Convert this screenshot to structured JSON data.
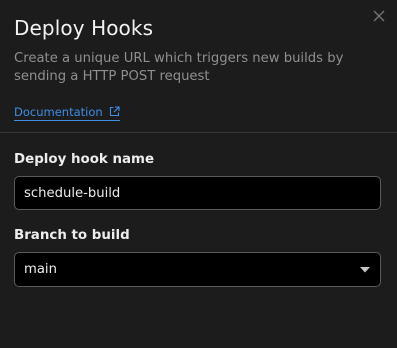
{
  "dialog": {
    "title": "Deploy Hooks",
    "description": "Create a unique URL which triggers new builds by sending a HTTP POST request",
    "doc_link": "Documentation"
  },
  "form": {
    "hook_name": {
      "label": "Deploy hook name",
      "value": "schedule-build"
    },
    "branch": {
      "label": "Branch to build",
      "value": "main"
    }
  },
  "icons": {
    "close": "close-icon",
    "external": "external-link-icon",
    "caret": "caret-down-icon"
  },
  "colors": {
    "background": "#1c1c1c",
    "link": "#3e8ee6",
    "input_bg": "#000000",
    "border": "#5a5a5a"
  }
}
